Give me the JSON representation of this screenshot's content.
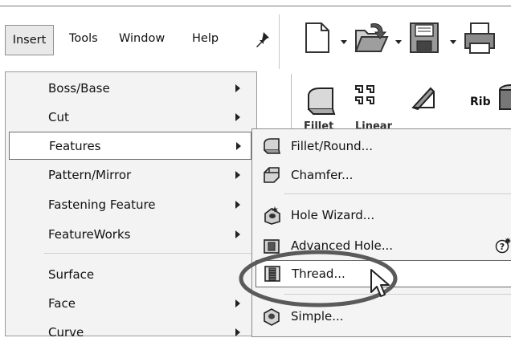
{
  "menubar": {
    "items": [
      {
        "id": "insert",
        "label": "Insert"
      },
      {
        "id": "tools",
        "label": "Tools"
      },
      {
        "id": "window",
        "label": "Window"
      },
      {
        "id": "help",
        "label": "Help"
      }
    ],
    "pin_icon": "pin-icon"
  },
  "toolbar": {
    "icons": [
      "new-document-icon",
      "open-folder-icon",
      "save-icon",
      "print-icon"
    ]
  },
  "features_bar": {
    "rib_label": "Rib",
    "partial_labels": [
      "Fillet",
      "Linear"
    ]
  },
  "insert_menu": {
    "items": [
      {
        "label": "Boss/Base",
        "has_submenu": true
      },
      {
        "label": "Cut",
        "has_submenu": true
      },
      {
        "label": "Features",
        "has_submenu": true,
        "highlighted": true
      },
      {
        "label": "Pattern/Mirror",
        "has_submenu": true
      },
      {
        "label": "Fastening Feature",
        "has_submenu": true
      },
      {
        "label": "FeatureWorks",
        "has_submenu": true
      },
      {
        "label": "Surface",
        "has_submenu": false
      },
      {
        "label": "Face",
        "has_submenu": true
      },
      {
        "label": "Curve",
        "has_submenu": true
      }
    ]
  },
  "features_submenu": {
    "items": [
      {
        "label": "Fillet/Round...",
        "icon": "fillet-icon"
      },
      {
        "label": "Chamfer...",
        "icon": "chamfer-icon"
      },
      {
        "label": "Hole Wizard...",
        "icon": "hole-wizard-icon"
      },
      {
        "label": "Advanced Hole...",
        "icon": "advanced-hole-icon"
      },
      {
        "label": "Thread...",
        "icon": "thread-icon",
        "highlighted": true
      },
      {
        "label": "Simple...",
        "icon": "simple-hole-icon"
      }
    ]
  },
  "annotation": {
    "shape": "ellipse",
    "target": "Thread...",
    "color": "#555555"
  }
}
